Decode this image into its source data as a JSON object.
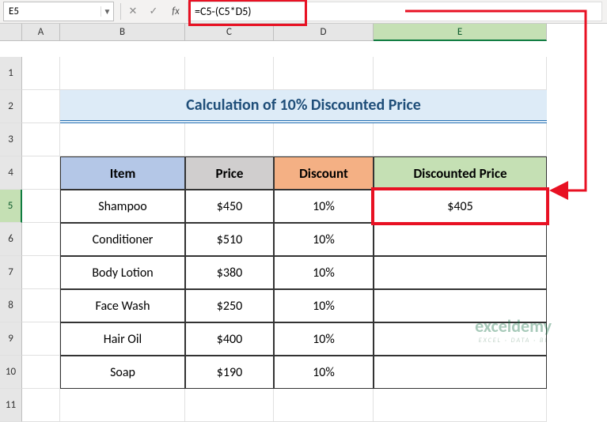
{
  "formula_bar": {
    "cell_ref": "E5",
    "fx_label": "fx",
    "formula": "=C5-(C5*D5)"
  },
  "columns": [
    "A",
    "B",
    "C",
    "D",
    "E"
  ],
  "rows": [
    "1",
    "2",
    "3",
    "4",
    "5",
    "6",
    "7",
    "8",
    "9",
    "10",
    "11"
  ],
  "title": "Calculation of 10% Discounted Price",
  "headers": {
    "item": "Item",
    "price": "Price",
    "discount": "Discount",
    "discounted_price": "Discounted Price"
  },
  "currency_symbol": "$",
  "table": [
    {
      "item": "Shampoo",
      "price": "450",
      "discount": "10%",
      "discounted_price": "405"
    },
    {
      "item": "Conditioner",
      "price": "510",
      "discount": "10%",
      "discounted_price": ""
    },
    {
      "item": "Body Lotion",
      "price": "380",
      "discount": "10%",
      "discounted_price": ""
    },
    {
      "item": "Face Wash",
      "price": "250",
      "discount": "10%",
      "discounted_price": ""
    },
    {
      "item": "Hair Oil",
      "price": "400",
      "discount": "10%",
      "discounted_price": ""
    },
    {
      "item": "Soap",
      "price": "190",
      "discount": "10%",
      "discounted_price": ""
    }
  ],
  "watermark": {
    "big": "exceldemy",
    "tiny": "EXCEL · DATA · BI"
  },
  "active_cell_row": 5,
  "chart_data": {
    "type": "table",
    "title": "Calculation of 10% Discounted Price",
    "columns": [
      "Item",
      "Price",
      "Discount",
      "Discounted Price"
    ],
    "rows": [
      [
        "Shampoo",
        450,
        "10%",
        405
      ],
      [
        "Conditioner",
        510,
        "10%",
        null
      ],
      [
        "Body Lotion",
        380,
        "10%",
        null
      ],
      [
        "Face Wash",
        250,
        "10%",
        null
      ],
      [
        "Hair Oil",
        400,
        "10%",
        null
      ],
      [
        "Soap",
        190,
        "10%",
        null
      ]
    ],
    "formula": "=C5-(C5*D5)"
  }
}
